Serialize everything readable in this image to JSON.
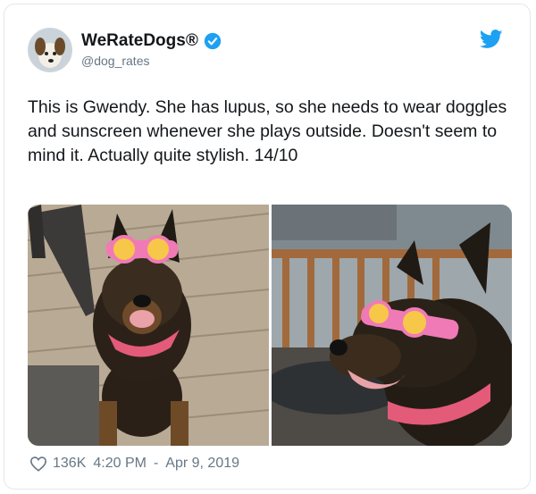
{
  "account": {
    "display_name": "WeRateDogs®",
    "handle": "@dog_rates"
  },
  "tweet": {
    "text": "This is Gwendy. She has lupus, so she needs to wear doggles and sunscreen whenever she plays outside. Doesn't seem to mind it. Actually quite stylish. 14/10"
  },
  "footer": {
    "likes": "136K",
    "time": "4:20 PM",
    "separator": "-",
    "date": "Apr 9, 2019"
  },
  "icons": {
    "verified": "verified-badge-icon",
    "logo": "twitter-bird-icon",
    "like": "heart-icon"
  },
  "colors": {
    "brand_blue": "#1da1f2",
    "secondary_text": "#657786",
    "border": "#e1e8ed"
  }
}
